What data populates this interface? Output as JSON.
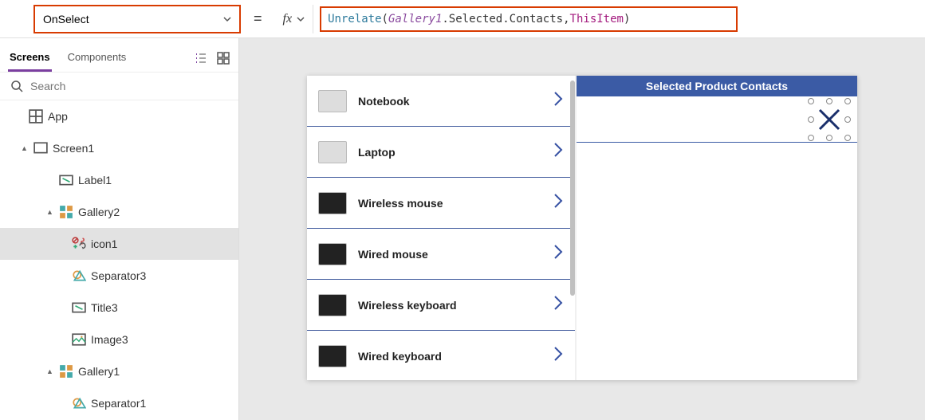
{
  "property_selector": {
    "value": "OnSelect"
  },
  "equals": "=",
  "fx_label": "fx",
  "formula": {
    "fn": "Unrelate",
    "open": "( ",
    "obj": "Gallery1",
    "dot_contacts": ".Selected.Contacts, ",
    "thisitem": "ThisItem",
    "close": " )"
  },
  "panel": {
    "tab_screens": "Screens",
    "tab_components": "Components",
    "search_placeholder": "Search"
  },
  "tree": [
    {
      "label": "App",
      "depth": 0,
      "icon": "app-icon",
      "toggle": ""
    },
    {
      "label": "Screen1",
      "depth": 1,
      "icon": "screen-icon",
      "toggle": "▲"
    },
    {
      "label": "Label1",
      "depth": 2,
      "icon": "label-icon",
      "toggle": ""
    },
    {
      "label": "Gallery2",
      "depth": 2,
      "icon": "gallery-icon",
      "toggle": "▲"
    },
    {
      "label": "icon1",
      "depth": 3,
      "icon": "icon-icon",
      "toggle": "",
      "selected": true
    },
    {
      "label": "Separator3",
      "depth": 3,
      "icon": "separator-icon",
      "toggle": ""
    },
    {
      "label": "Title3",
      "depth": 3,
      "icon": "label-icon",
      "toggle": ""
    },
    {
      "label": "Image3",
      "depth": 3,
      "icon": "image-icon",
      "toggle": ""
    },
    {
      "label": "Gallery1",
      "depth": 2,
      "icon": "gallery-icon",
      "toggle": "▲"
    },
    {
      "label": "Separator1",
      "depth": 3,
      "icon": "separator-icon",
      "toggle": ""
    }
  ],
  "products": [
    {
      "name": "Notebook",
      "thumb": "light"
    },
    {
      "name": "Laptop",
      "thumb": "light"
    },
    {
      "name": "Wireless mouse",
      "thumb": "dark"
    },
    {
      "name": "Wired mouse",
      "thumb": "dark"
    },
    {
      "name": "Wireless keyboard",
      "thumb": "dark"
    },
    {
      "name": "Wired keyboard",
      "thumb": "dark"
    }
  ],
  "contacts_panel": {
    "header": "Selected Product Contacts"
  }
}
